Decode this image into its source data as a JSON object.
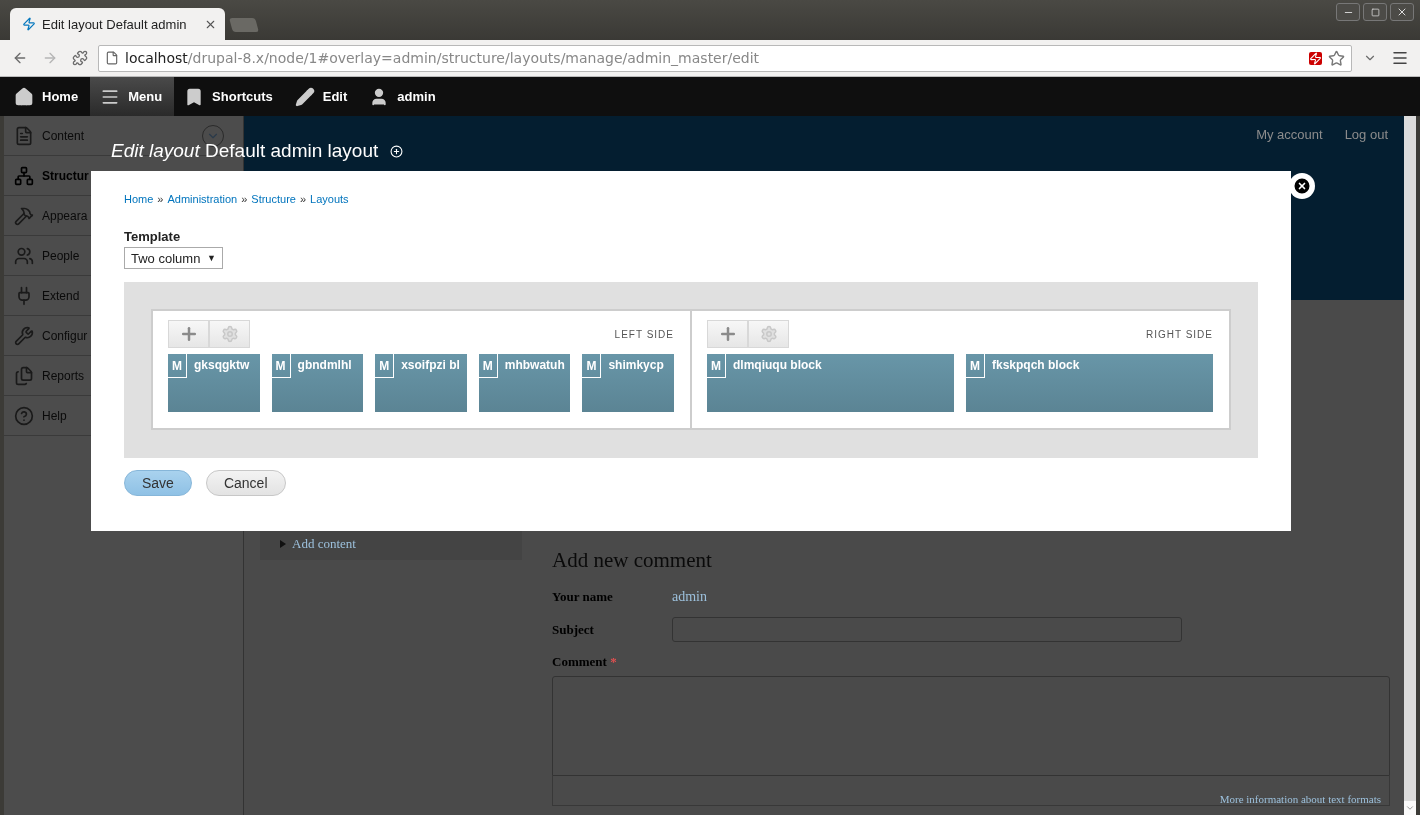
{
  "browser": {
    "tab_title": "Edit layout Default admin",
    "url_host": "localhost",
    "url_path": "/drupal-8.x/node/1#overlay=admin/structure/layouts/manage/admin_master/edit"
  },
  "toolbar": [
    {
      "label": "Home",
      "kind": "home",
      "selected": false
    },
    {
      "label": "Menu",
      "kind": "menu",
      "selected": true
    },
    {
      "label": "Shortcuts",
      "kind": "shortcuts",
      "selected": false
    },
    {
      "label": "Edit",
      "kind": "edit",
      "selected": false
    },
    {
      "label": "admin",
      "kind": "user",
      "selected": false
    }
  ],
  "sidebar": [
    {
      "label": "Content",
      "kind": "content",
      "selected": false,
      "toggle": true
    },
    {
      "label": "Structur",
      "kind": "structure",
      "selected": true,
      "toggle": false
    },
    {
      "label": "Appeara",
      "kind": "appearance",
      "selected": false,
      "toggle": false
    },
    {
      "label": "People",
      "kind": "people",
      "selected": false,
      "toggle": false
    },
    {
      "label": "Extend",
      "kind": "extend",
      "selected": false,
      "toggle": false
    },
    {
      "label": "Configur",
      "kind": "configuration",
      "selected": false,
      "toggle": false
    },
    {
      "label": "Reports",
      "kind": "reports",
      "selected": false,
      "toggle": false
    },
    {
      "label": "Help",
      "kind": "help",
      "selected": false,
      "toggle": false
    }
  ],
  "header_links": [
    "My account",
    "Log out"
  ],
  "background_page": {
    "add_content": "Add content",
    "comment_heading": "Add new comment",
    "your_name_label": "Your name",
    "your_name_value": "admin",
    "subject_label": "Subject",
    "comment_label": "Comment",
    "required_mark": "*",
    "help_link": "More information about text formats"
  },
  "dialog": {
    "title": "*Edit layout* Default admin layout",
    "breadcrumb": [
      "Home",
      "Administration",
      "Structure",
      "Layouts"
    ],
    "separator": "»",
    "template_label": "Template",
    "template_value": "Two column",
    "template_arrow": "▼",
    "regions": [
      {
        "label": "LEFT SIDE",
        "blocks": [
          {
            "badge": "M",
            "title": "gksqgktw"
          },
          {
            "badge": "M",
            "title": "gbndmlhl"
          },
          {
            "badge": "M",
            "title": "xsoifpzi bl"
          },
          {
            "badge": "M",
            "title": "mhbwatuh"
          },
          {
            "badge": "M",
            "title": "shimkycp"
          }
        ]
      },
      {
        "label": "RIGHT SIDE",
        "blocks": [
          {
            "badge": "M",
            "title": "dlmqiuqu block"
          },
          {
            "badge": "M",
            "title": "fkskpqch block"
          }
        ]
      }
    ],
    "buttons": [
      {
        "label": "Save",
        "kind": "primary"
      },
      {
        "label": "Cancel",
        "kind": "secondary"
      }
    ]
  }
}
